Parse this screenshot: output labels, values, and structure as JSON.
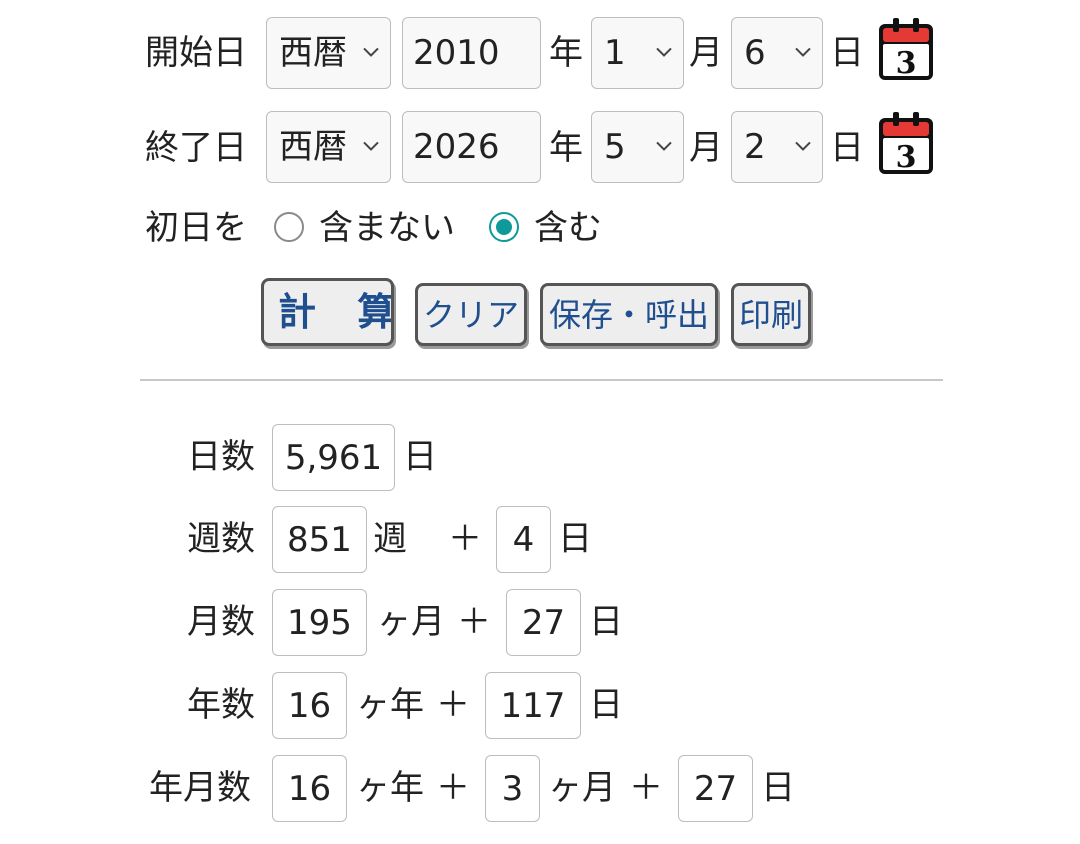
{
  "form": {
    "start": {
      "label": "開始日",
      "era": "西暦",
      "year": "2010",
      "year_unit": "年",
      "month": "1",
      "month_unit": "月",
      "day": "6",
      "day_unit": "日"
    },
    "end": {
      "label": "終了日",
      "era": "西暦",
      "year": "2026",
      "year_unit": "年",
      "month": "5",
      "month_unit": "月",
      "day": "2",
      "day_unit": "日"
    },
    "first_day": {
      "label": "初日を",
      "option_exclude": "含まない",
      "option_include": "含む",
      "selected": "include"
    },
    "calendar_icon_day": "3"
  },
  "buttons": {
    "calculate": "計 算",
    "clear": "クリア",
    "save_load": "保存・呼出",
    "print": "印刷"
  },
  "results": {
    "days": {
      "label": "日数",
      "value": "5,961",
      "unit": "日"
    },
    "weeks": {
      "label": "週数",
      "value": "851",
      "unit": "週",
      "plus": "＋",
      "rem_value": "4",
      "rem_unit": "日"
    },
    "months": {
      "label": "月数",
      "value": "195",
      "unit": "ヶ月",
      "plus": "＋",
      "rem_value": "27",
      "rem_unit": "日"
    },
    "years": {
      "label": "年数",
      "value": "16",
      "unit": "ヶ年",
      "plus": "＋",
      "rem_value": "117",
      "rem_unit": "日"
    },
    "ymd": {
      "label": "年月数",
      "years": "16",
      "years_unit": "ヶ年",
      "plus1": "＋",
      "months": "3",
      "months_unit": "ヶ月",
      "plus2": "＋",
      "days": "27",
      "days_unit": "日"
    }
  },
  "colors": {
    "button_text": "#1f4f8f",
    "radio_accent": "#0f9a9a",
    "calendar_red": "#e53935"
  }
}
